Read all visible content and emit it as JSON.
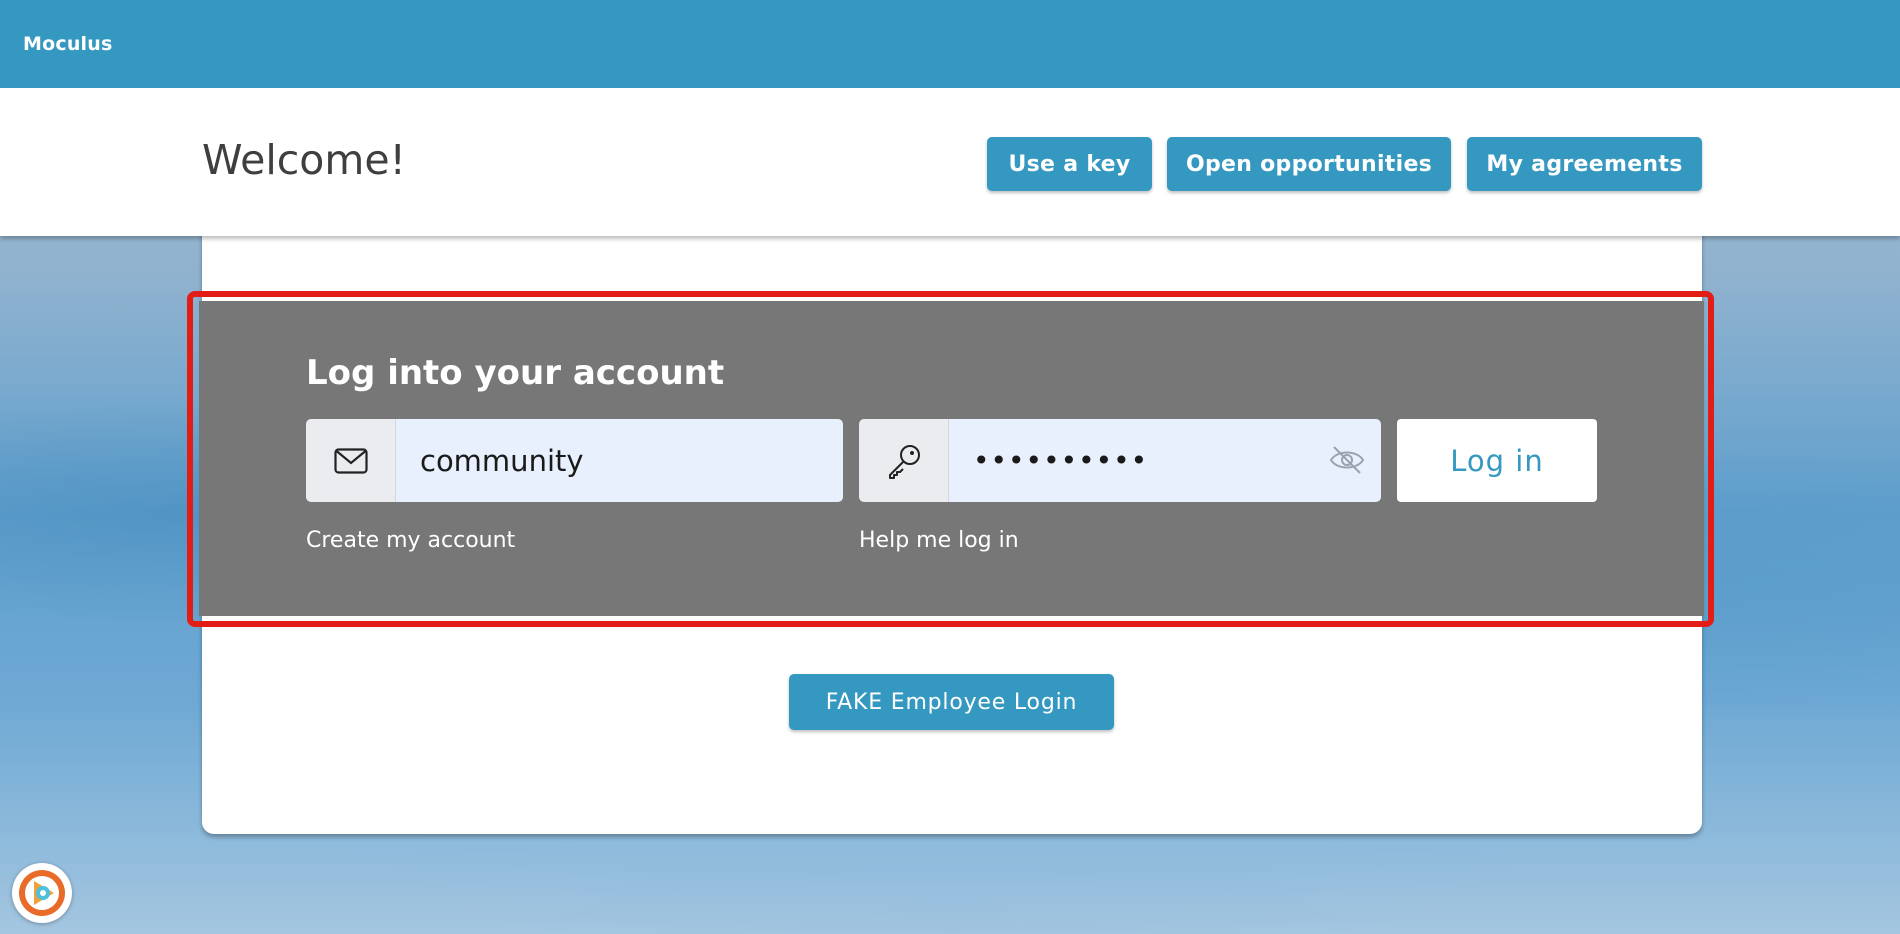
{
  "app": {
    "brand": "Moculus"
  },
  "header": {
    "title": "Welcome!",
    "buttons": [
      {
        "label": "Use a key"
      },
      {
        "label": "Open opportunities"
      },
      {
        "label": "My agreements"
      }
    ]
  },
  "login": {
    "title": "Log into your account",
    "email": {
      "value": "community",
      "icon": "envelope-icon"
    },
    "password": {
      "value": "••••••••••",
      "icon": "key-icon",
      "toggle_icon": "eye-slash-icon"
    },
    "submit_label": "Log in",
    "create_account": "Create my account",
    "help": "Help me log in"
  },
  "employee_login": {
    "label": "FAKE Employee Login"
  },
  "colors": {
    "primary": "#3598c1",
    "panel": "#777777",
    "highlight": "#e31d16",
    "input_bg": "#e8f0fd"
  }
}
